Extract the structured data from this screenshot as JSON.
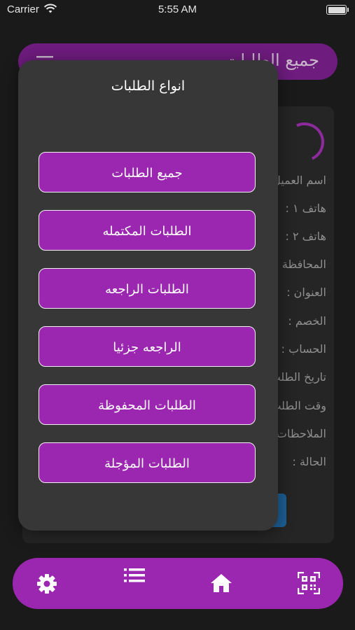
{
  "status_bar": {
    "carrier": "Carrier",
    "time": "5:55 AM"
  },
  "header": {
    "title": "جميع الطلبات"
  },
  "background_details": {
    "labels": [
      "اسم العميل",
      "هاتف ١ :",
      "هاتف ٢ :",
      "المحافظة",
      "العنوان :",
      "الخصم :",
      "الحساب :",
      "تاريخ الطلب",
      "وقت الطلب",
      "الملاحظات",
      "الحالة :"
    ]
  },
  "modal": {
    "title": "انواع الطلبات",
    "buttons": [
      "جميع الطلبات",
      "الطلبات المكتمله",
      "الطلبات الراجعه",
      "الراجعه جزئيا",
      "الطلبات المحفوظة",
      "الطلبات المؤجلة"
    ]
  },
  "bottom_nav": {
    "items": [
      "gear-icon",
      "list-icon",
      "home-icon",
      "qr-code-icon"
    ],
    "background_color": "#9b27b0"
  },
  "colors": {
    "accent": "#9b27b0",
    "header_bg": "#6e1c7e",
    "modal_bg": "#373737"
  }
}
